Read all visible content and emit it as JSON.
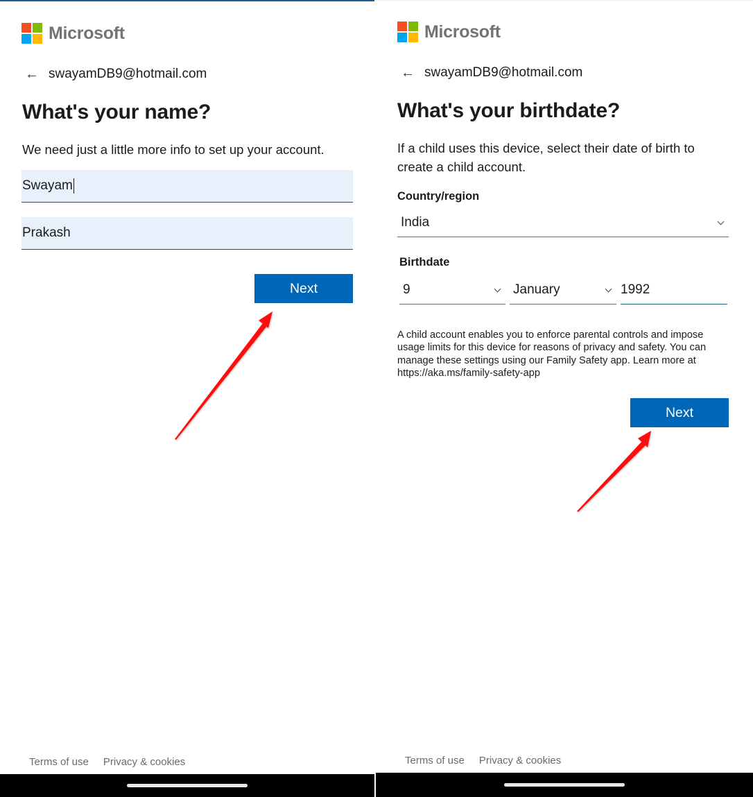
{
  "brand": {
    "name": "Microsoft",
    "logo_colors": [
      "#f25022",
      "#7fba00",
      "#00a4ef",
      "#ffb900"
    ],
    "accent_color": "#0067b8",
    "annotation_arrow_color": "#ff0000"
  },
  "left_screen": {
    "back_icon": "arrow-left-icon",
    "email": "swayamDB9@hotmail.com",
    "title": "What's your name?",
    "description": "We need just a little more info to set up your account.",
    "first_name_value": "Swayam",
    "last_name_value": "Prakash",
    "next_label": "Next",
    "footer": {
      "terms": "Terms of use",
      "privacy": "Privacy & cookies"
    }
  },
  "right_screen": {
    "back_icon": "arrow-left-icon",
    "email": "swayamDB9@hotmail.com",
    "title": "What's your birthdate?",
    "description": "If a child uses this device, select their date of birth to create a child account.",
    "country_label": "Country/region",
    "country_value": "India",
    "birthdate_label": "Birthdate",
    "day_value": "9",
    "month_value": "January",
    "year_value": "1992",
    "info_text": "A child account enables you to enforce parental controls and impose usage limits for this device for reasons of privacy and safety. You can manage these settings using our Family Safety app. Learn more at https://aka.ms/family-safety-app",
    "next_label": "Next",
    "footer": {
      "terms": "Terms of use",
      "privacy": "Privacy & cookies"
    }
  }
}
